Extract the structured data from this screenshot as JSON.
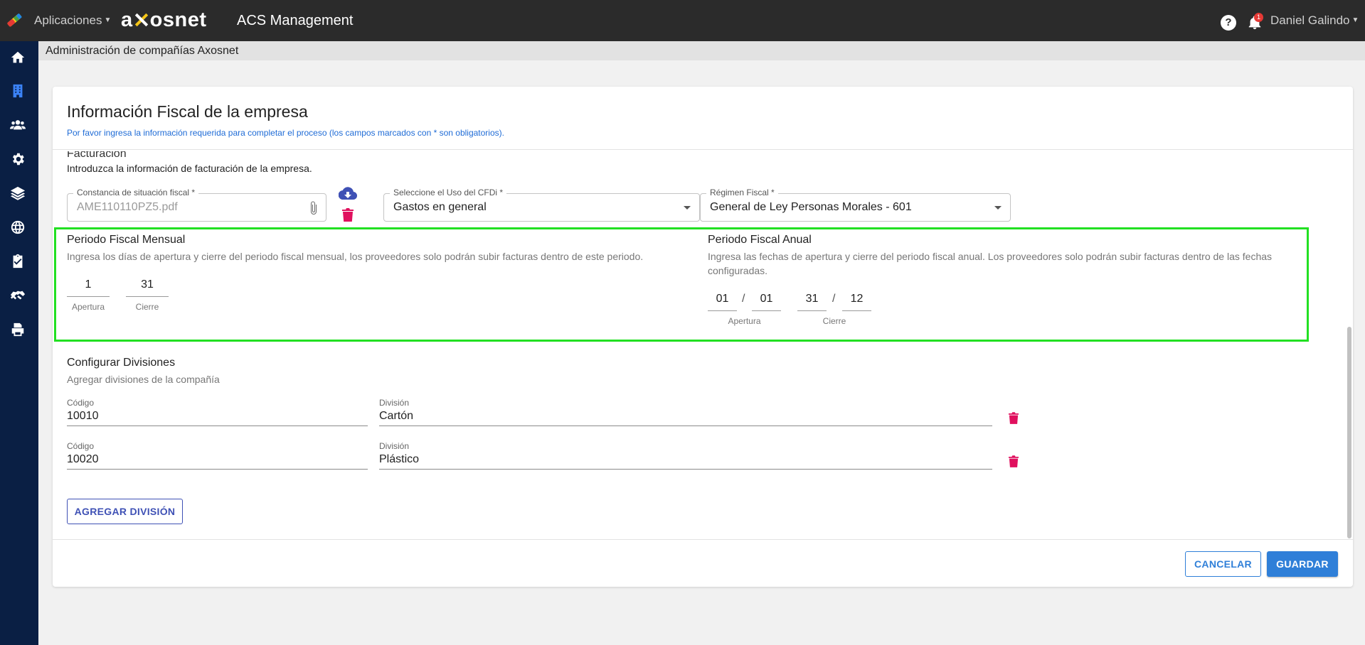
{
  "topbar": {
    "apps_label": "Aplicaciones",
    "brand_pre": "a",
    "brand_post": "osnet",
    "app_title": "ACS Management",
    "help_glyph": "?",
    "notifications_count": "1",
    "user_name": "Daniel Galindo"
  },
  "sidebar": {
    "items": [
      {
        "icon": "home-icon"
      },
      {
        "icon": "building-icon",
        "active": true
      },
      {
        "icon": "users-icon"
      },
      {
        "icon": "gear-icon"
      },
      {
        "icon": "layers-icon"
      },
      {
        "icon": "globe-icon"
      },
      {
        "icon": "clipboard-check-icon"
      },
      {
        "icon": "handshake-icon"
      },
      {
        "icon": "print-icon"
      }
    ]
  },
  "breadcrumb": "Administración de compañías Axosnet",
  "card": {
    "title": "Información Fiscal de la empresa",
    "subtitle": "Por favor ingresa la información requerida para completar el proceso (los campos marcados con * son obligatorios).",
    "facturacion": {
      "title": "Facturacion",
      "description": "Introduzca la información de facturación de la empresa.",
      "constancia": {
        "label": "Constancia de situación fiscal *",
        "value": "AME110110PZ5.pdf"
      },
      "cfdi": {
        "label": "Seleccione el Uso del CFDi *",
        "value": "Gastos en general"
      },
      "regimen": {
        "label": "Régimen Fiscal *",
        "value": "General de Ley Personas Morales - 601"
      }
    },
    "mensual": {
      "title": "Periodo Fiscal Mensual",
      "description": "Ingresa los días de apertura y cierre del periodo fiscal mensual, los proveedores solo podrán subir facturas dentro de este periodo.",
      "apertura_value": "1",
      "cierre_value": "31",
      "apertura_label": "Apertura",
      "cierre_label": "Cierre"
    },
    "anual": {
      "title": "Periodo Fiscal Anual",
      "description": "Ingresa las fechas de apertura y cierre del periodo fiscal anual. Los proveedores solo podrán subir facturas dentro de las fechas configuradas.",
      "apertura_day": "01",
      "apertura_month": "01",
      "cierre_day": "31",
      "cierre_month": "12",
      "separator": "/",
      "apertura_label": "Apertura",
      "cierre_label": "Cierre"
    },
    "divisiones": {
      "title": "Configurar Divisiones",
      "description": "Agregar divisiones de la compañía",
      "rows": [
        {
          "codigo_label": "Código",
          "codigo": "10010",
          "division_label": "División",
          "division": "Cartón"
        },
        {
          "codigo_label": "Código",
          "codigo": "10020",
          "division_label": "División",
          "division": "Plástico"
        }
      ],
      "add_button": "AGREGAR DIVISIÓN"
    },
    "cancel_button": "CANCELAR",
    "save_button": "GUARDAR"
  },
  "colors": {
    "topbar": "#2b2b2b",
    "sidebar": "#0a1f44",
    "accent": "#2f7fd8",
    "delete": "#e0105e",
    "highlight": "#22e022"
  }
}
